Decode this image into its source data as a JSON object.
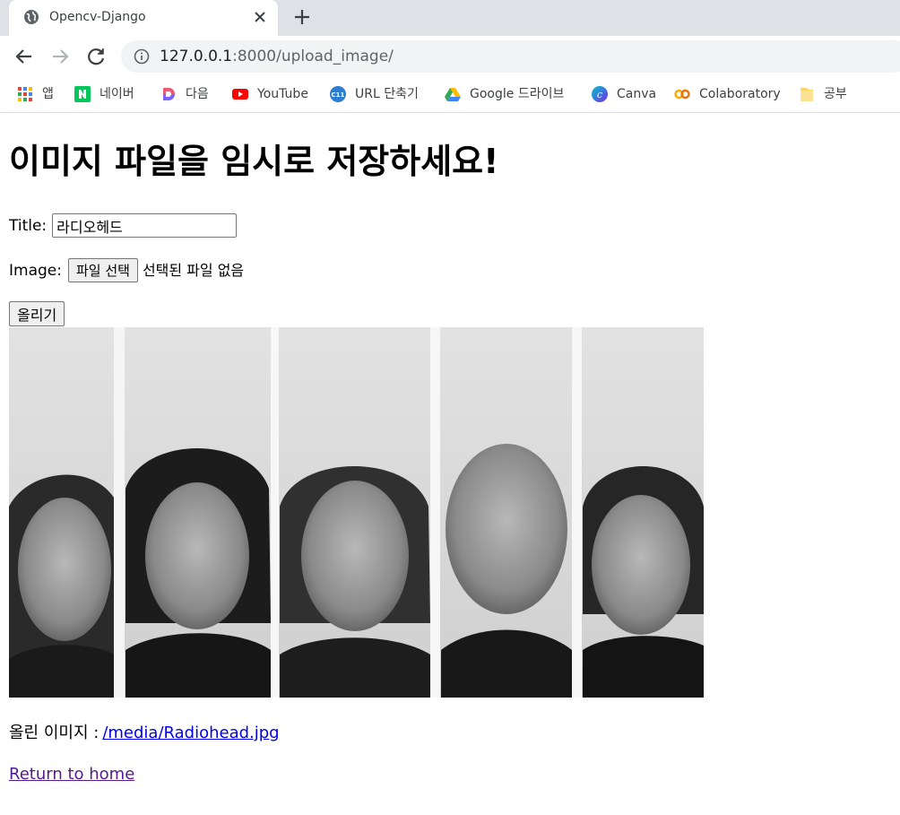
{
  "browser": {
    "tab_title": "Opencv-Django",
    "url_host": "127.0.0.1",
    "url_rest": ":8000/upload_image/",
    "bookmarks": [
      {
        "label": "앱",
        "icon": "apps-grid-icon"
      },
      {
        "label": "네이버",
        "icon": "naver-icon"
      },
      {
        "label": "다음",
        "icon": "daum-icon"
      },
      {
        "label": "YouTube",
        "icon": "youtube-icon"
      },
      {
        "label": "URL 단축기",
        "icon": "url-shortener-icon"
      },
      {
        "label": "Google 드라이브",
        "icon": "google-drive-icon"
      },
      {
        "label": "Canva",
        "icon": "canva-icon"
      },
      {
        "label": "Colaboratory",
        "icon": "colab-icon"
      },
      {
        "label": "공부",
        "icon": "folder-icon"
      }
    ]
  },
  "page": {
    "heading": "이미지 파일을 임시로 저장하세요!",
    "form": {
      "title_label": "Title:",
      "title_value": "라디오헤드",
      "image_label": "Image:",
      "file_button_label": "파일 선택",
      "file_status": "선택된 파일 없음",
      "submit_label": "올리기"
    },
    "uploaded_label": "올린 이미지 :",
    "uploaded_link": "/media/Radiohead.jpg",
    "return_link": "Return to home"
  },
  "colors": {
    "tabstrip": "#dee1e6",
    "omnibox": "#f1f3f4",
    "link": "#0000ee",
    "visited_link": "#551a8b"
  }
}
